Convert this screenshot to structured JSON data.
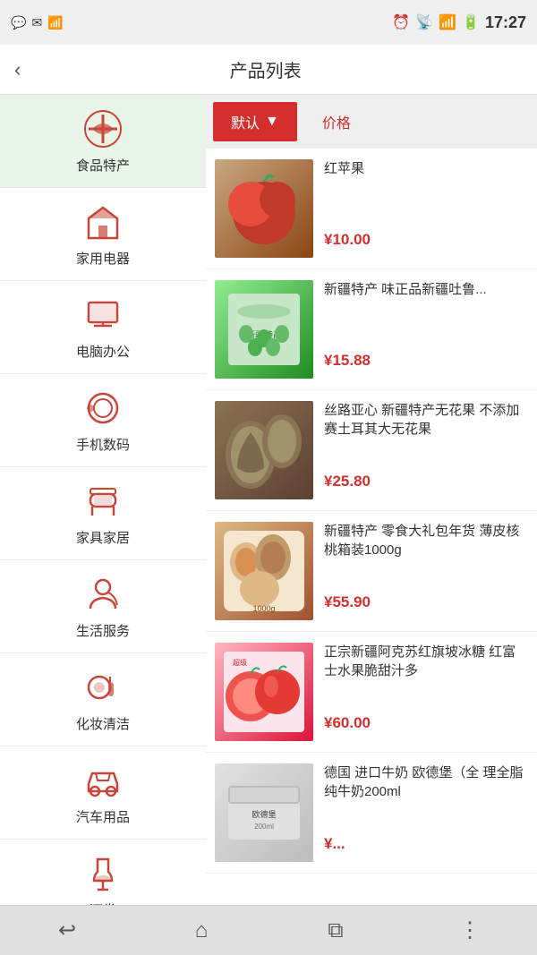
{
  "statusBar": {
    "time": "17:27",
    "icons": [
      "wechat",
      "message",
      "wifi",
      "alarm",
      "wifi2",
      "signal",
      "battery"
    ]
  },
  "header": {
    "backLabel": "‹",
    "title": "产品列表"
  },
  "sidebar": {
    "items": [
      {
        "id": "food",
        "label": "食品特产",
        "active": true
      },
      {
        "id": "appliance",
        "label": "家用电器",
        "active": false
      },
      {
        "id": "computer",
        "label": "电脑办公",
        "active": false
      },
      {
        "id": "phone",
        "label": "手机数码",
        "active": false
      },
      {
        "id": "furniture",
        "label": "家具家居",
        "active": false
      },
      {
        "id": "life",
        "label": "生活服务",
        "active": false
      },
      {
        "id": "cosmetic",
        "label": "化妆清洁",
        "active": false
      },
      {
        "id": "car",
        "label": "汽车用品",
        "active": false
      },
      {
        "id": "wine",
        "label": "酒类",
        "active": false
      }
    ]
  },
  "sortBar": {
    "activeLabel": "默认",
    "activeArrow": "▼",
    "inactiveLabel": "价格"
  },
  "products": [
    {
      "id": 1,
      "name": "红苹果",
      "price": "¥10.00",
      "imgClass": "img-apple",
      "imgText": "🍎"
    },
    {
      "id": 2,
      "name": "新疆特产 味正品新疆吐鲁...",
      "price": "¥15.88",
      "imgClass": "img-grapes",
      "imgText": "🍇"
    },
    {
      "id": 3,
      "name": "丝路亚心 新疆特产无花果 不添加赛土耳其大无花果",
      "price": "¥25.80",
      "imgClass": "img-figs",
      "imgText": "🌿"
    },
    {
      "id": 4,
      "name": "新疆特产 零食大礼包年货 薄皮核桃箱装1000g",
      "price": "¥55.90",
      "imgClass": "img-nuts",
      "imgText": "🥜"
    },
    {
      "id": 5,
      "name": "正宗新疆阿克苏红旗坡冰糖 红富士水果脆甜汁多",
      "price": "¥60.00",
      "imgClass": "img-apples2",
      "imgText": "🍏"
    },
    {
      "id": 6,
      "name": "德国 进口牛奶 欧德堡（全 理全脂纯牛奶200ml",
      "price": "¥...",
      "imgClass": "img-milk",
      "imgText": "🥛"
    }
  ],
  "bottomNav": {
    "back": "↩",
    "home": "⌂",
    "recent": "⧉",
    "menu": "⋮"
  }
}
